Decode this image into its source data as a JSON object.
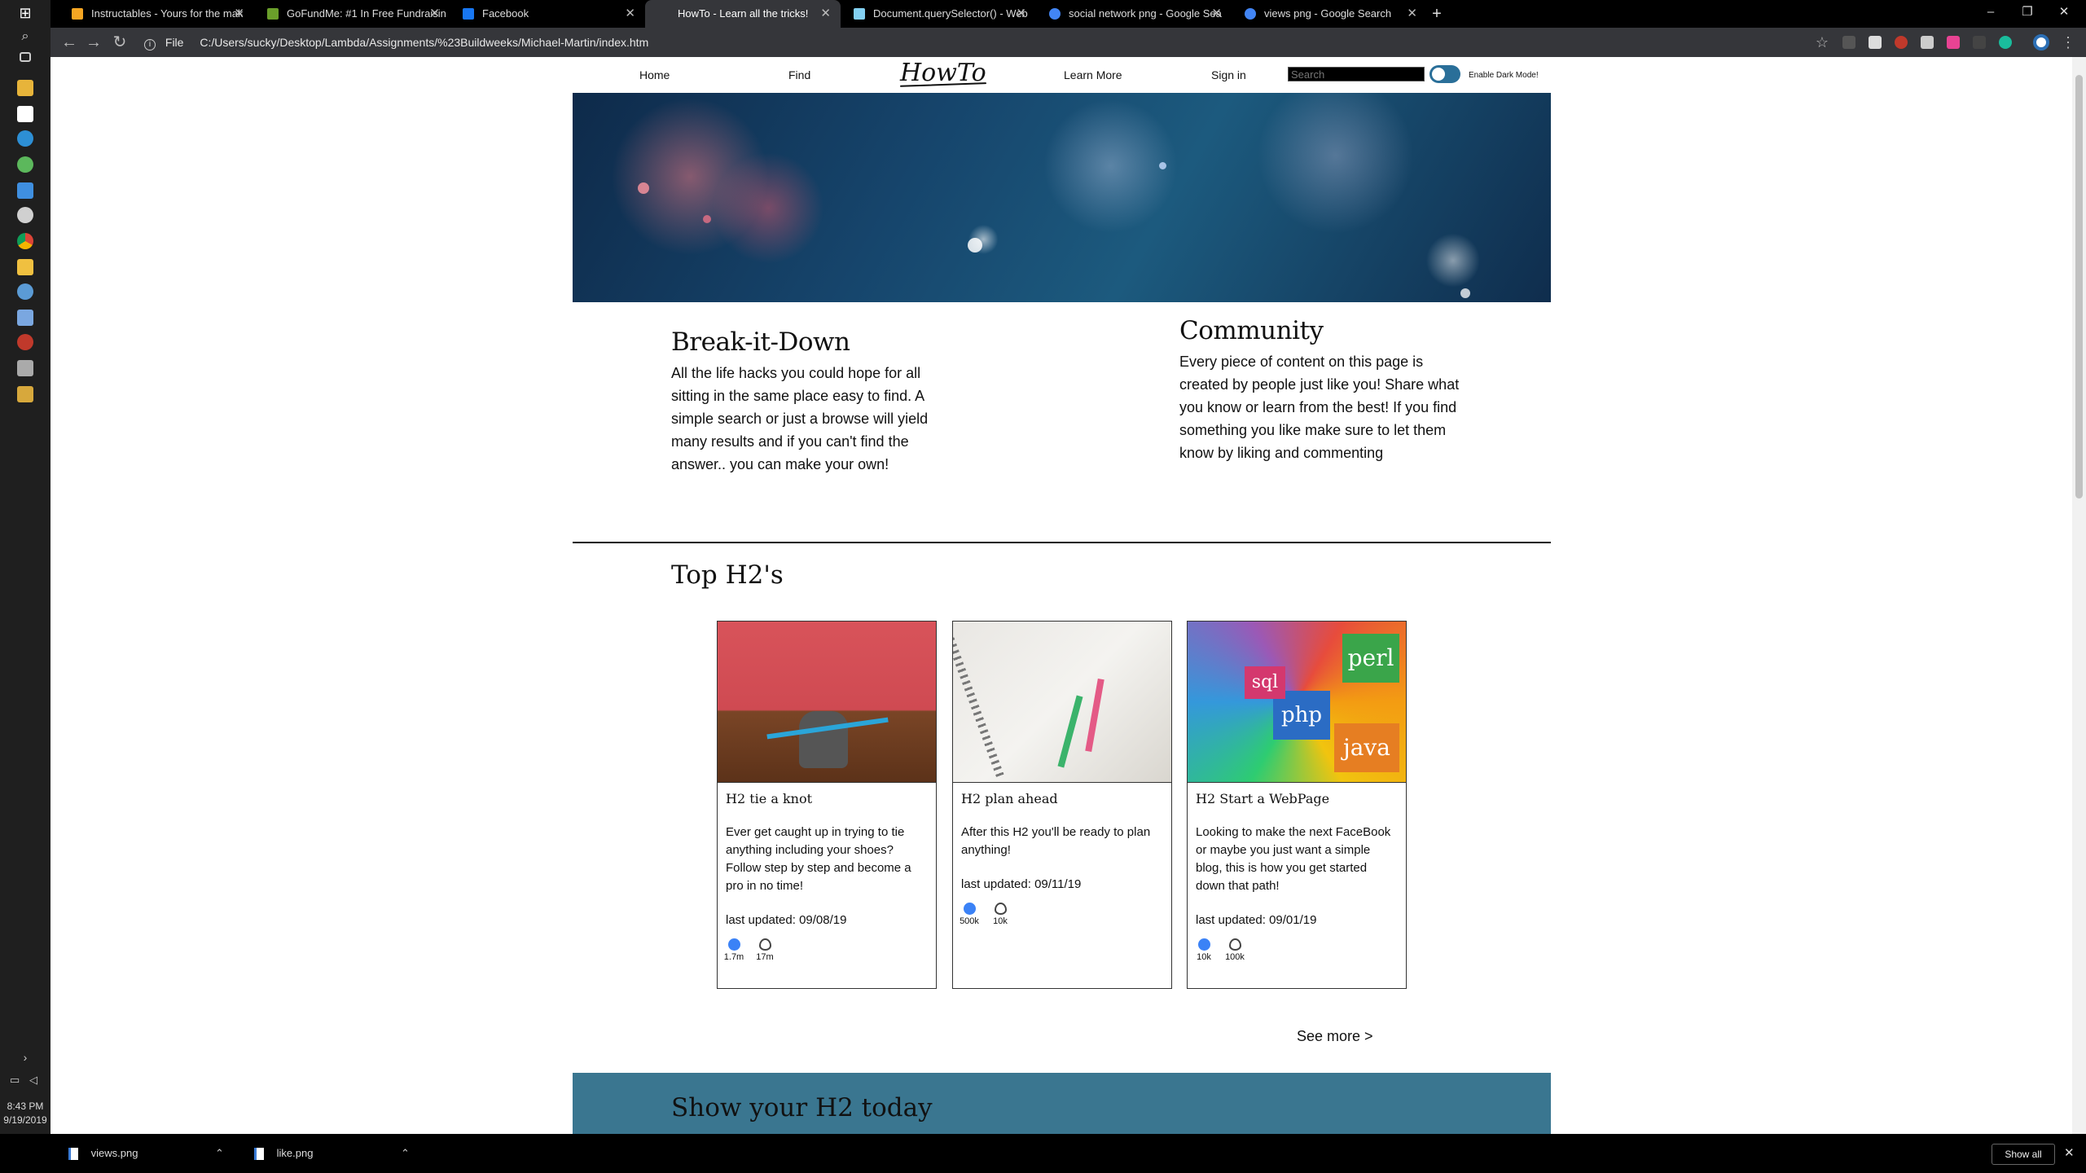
{
  "browser": {
    "tabs": [
      {
        "title": "Instructables - Yours for the mak",
        "icon": "instructables-icon",
        "color": "#f5a623"
      },
      {
        "title": "GoFundMe: #1 In Free Fundraisin",
        "icon": "gofundme-icon",
        "color": "#6a9f2a"
      },
      {
        "title": "Facebook",
        "icon": "facebook-icon",
        "color": "#1877f2"
      },
      {
        "title": "HowTo - Learn all the tricks!",
        "icon": "page-icon",
        "color": "#888888",
        "active": true
      },
      {
        "title": "Document.querySelector() - Web",
        "icon": "mdn-icon",
        "color": "#83d0f2"
      },
      {
        "title": "social network png - Google Sea",
        "icon": "google-icon",
        "color": "#4285f4"
      },
      {
        "title": "views png - Google Search",
        "icon": "google-icon",
        "color": "#4285f4"
      }
    ],
    "address": {
      "scheme_label": "File",
      "url": "C:/Users/sucky/Desktop/Lambda/Assignments/%23Buildweeks/Michael-Martin/index.htm"
    }
  },
  "taskbar": {
    "time": "8:43 PM",
    "date": "9/19/2019"
  },
  "site": {
    "nav": {
      "home": "Home",
      "find": "Find",
      "logo": "HowTo",
      "learn_more": "Learn More",
      "sign_in": "Sign in",
      "search_placeholder": "Search",
      "dark_mode_label": "Enable Dark Mode!"
    },
    "features": [
      {
        "title": "Break-it-Down",
        "text": "All the life hacks you could hope for all sitting in the same place easy to find. A simple search or just a browse will yield many results and if you can't find the answer.. you can make your own!"
      },
      {
        "title": "Community",
        "text": "Every piece of content on this page is created by people just like you! Share what you know or learn from the best! If you find something you like make sure to let them know by liking and commenting"
      }
    ],
    "top_title": "Top H2's",
    "cards": [
      {
        "title": "H2 tie a knot",
        "desc": "Ever get caught up in trying to tie anything including your shoes? Follow step by step and become a pro in no time!",
        "date": "last updated: 09/08/19",
        "likes": "1.7m",
        "views": "17m"
      },
      {
        "title": "H2 plan ahead",
        "desc": "After this H2 you'll be ready to plan anything!",
        "date": "last updated: 09/11/19",
        "likes": "500k",
        "views": "10k"
      },
      {
        "title": "H2 Start a WebPage",
        "desc": "Looking to make the next FaceBook or maybe you just want a simple blog, this is how you get started down that path!",
        "date": "last updated: 09/01/19",
        "likes": "10k",
        "views": "100k"
      }
    ],
    "see_more": "See more >",
    "cta_title": "Show your H2 today"
  },
  "downloads": {
    "items": [
      "views.png",
      "like.png"
    ],
    "show_all": "Show all"
  },
  "colors": {
    "accent": "#3a7690",
    "toggle": "#2a6f99"
  }
}
